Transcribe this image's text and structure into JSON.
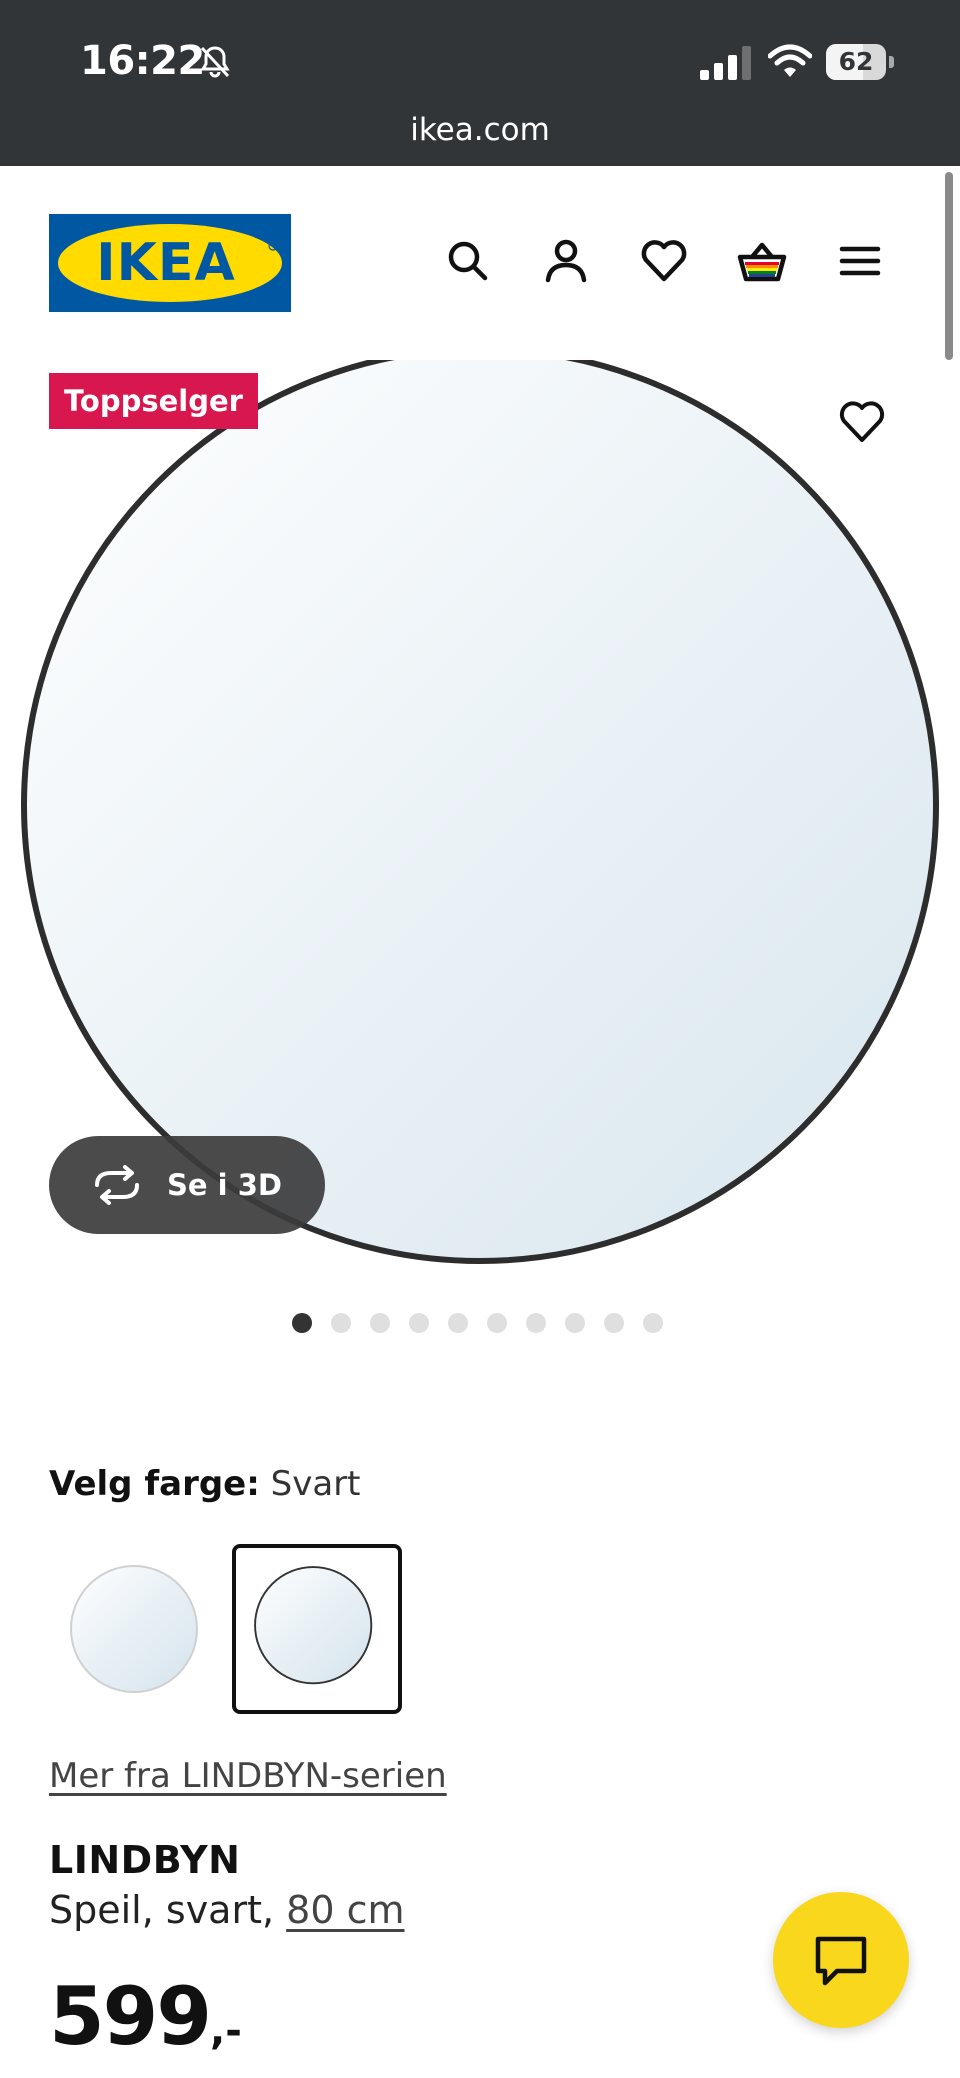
{
  "status_bar": {
    "time": "16:22",
    "battery": "62",
    "battery_level": 0.62,
    "icons": [
      "bell-off-icon",
      "signal-icon",
      "wifi-icon",
      "battery-icon"
    ]
  },
  "browser": {
    "url": "ikea.com"
  },
  "header": {
    "logo_text": "IKEA",
    "icons": [
      "search-icon",
      "profile-icon",
      "heart-icon",
      "basket-icon",
      "menu-icon"
    ]
  },
  "gallery": {
    "badge": "Toppselger",
    "view_3d_label": "Se i 3D",
    "dot_count": 10,
    "active_dot": 0
  },
  "color_selector": {
    "label": "Velg farge:",
    "value": "Svart",
    "options": [
      {
        "name": "Hvit",
        "selected": false
      },
      {
        "name": "Svart",
        "selected": true
      }
    ]
  },
  "series_link": "Mer fra LINDBYN-serien",
  "product": {
    "name": "LINDBYN",
    "description_prefix": "Speil, svart, ",
    "size": "80 cm",
    "price": "599",
    "price_suffix": ",-"
  },
  "colors": {
    "status_bar_bg": "#323538",
    "ikea_blue": "#0058a3",
    "ikea_yellow": "#ffdb00",
    "badge_bg": "#d8174f",
    "chat_button_bg": "#f9d71c"
  }
}
